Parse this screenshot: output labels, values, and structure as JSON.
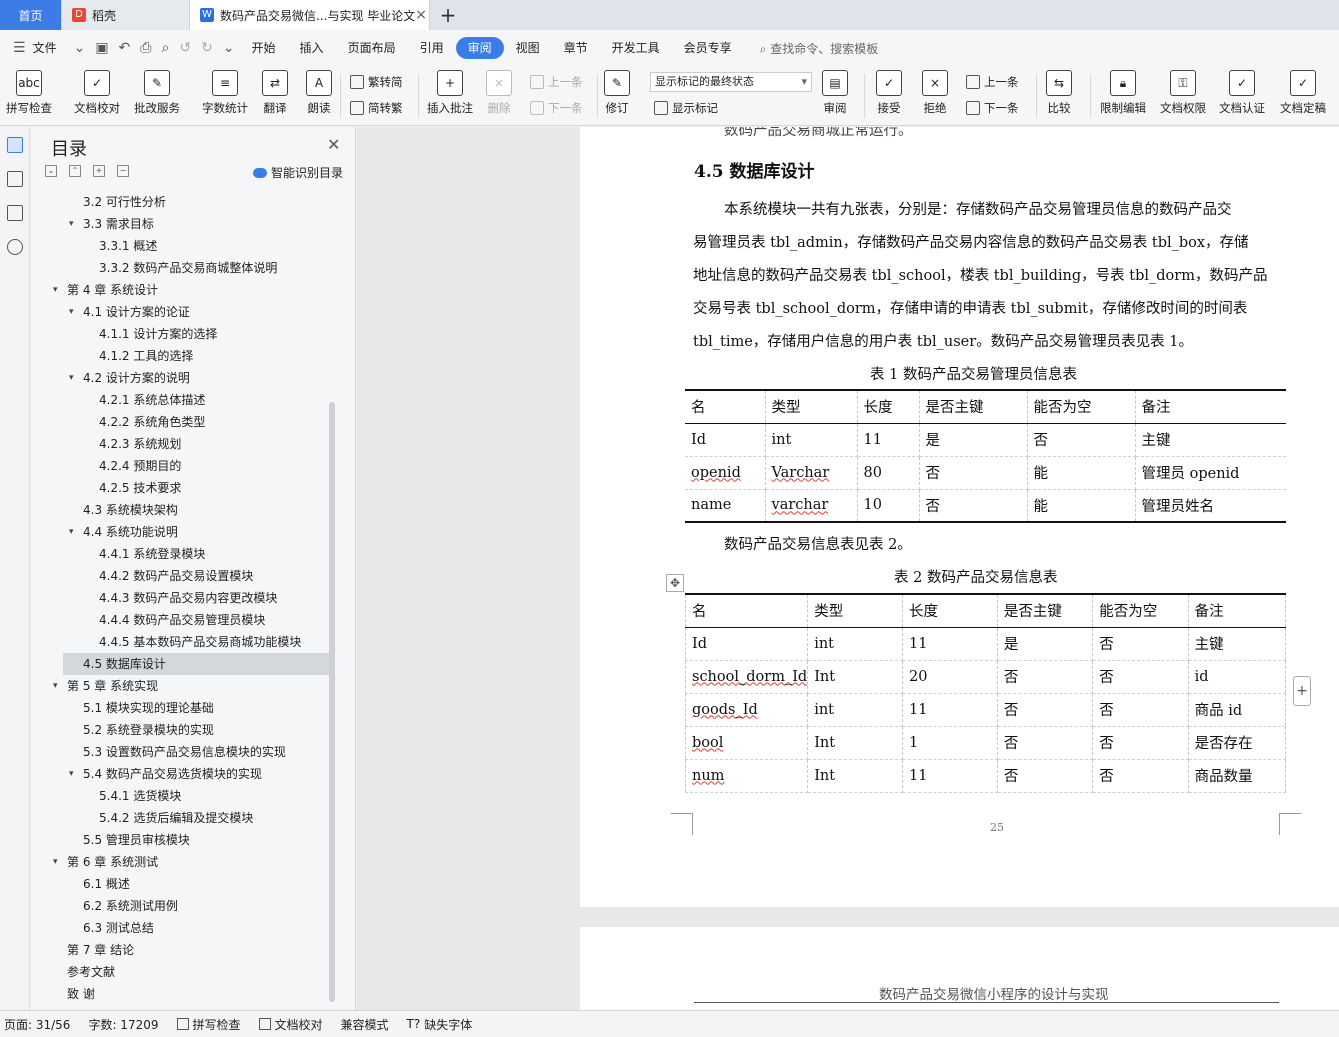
{
  "tabs": {
    "home": "首页",
    "daoke": "稻壳",
    "doc": "数码产品交易微信...与实现 毕业论文",
    "close": "×",
    "add": "+"
  },
  "menu": {
    "file": "文件",
    "items": [
      "开始",
      "插入",
      "页面布局",
      "引用",
      "审阅",
      "视图",
      "章节",
      "开发工具",
      "会员专享"
    ],
    "active": "审阅",
    "search": "查找命令、搜索模板"
  },
  "ribbon": {
    "spell": "拼写检查",
    "proof": "文档校对",
    "correct": "批改服务",
    "wordcount": "字数统计",
    "translate": "翻译",
    "read": "朗读",
    "trad": "繁转简",
    "simp": "简转繁",
    "insert_comment": "插入批注",
    "delete": "删除",
    "prev": "上一条",
    "next": "下一条",
    "revise": "修订",
    "markup_state": "显示标记的最终状态",
    "show_markup": "显示标记",
    "review": "审阅",
    "accept": "接受",
    "reject": "拒绝",
    "prev2": "上一条",
    "next2": "下一条",
    "compare": "比较",
    "restrict": "限制编辑",
    "permission": "文档权限",
    "certify": "文档认证",
    "finalize": "文档定稿"
  },
  "toc": {
    "title": "目录",
    "smart": "智能识别目录",
    "items": [
      {
        "label": "3.2  可行性分析",
        "level": 2
      },
      {
        "label": "3.3  需求目标",
        "level": 2,
        "caret": true
      },
      {
        "label": "3.3.1  概述",
        "level": 3
      },
      {
        "label": "3.3.2  数码产品交易商城整体说明",
        "level": 3
      },
      {
        "label": "第 4 章  系统设计",
        "level": 1,
        "caret": true
      },
      {
        "label": "4.1 设计方案的论证",
        "level": 2,
        "caret": true
      },
      {
        "label": "4.1.1  设计方案的选择",
        "level": 3
      },
      {
        "label": "4.1.2  工具的选择",
        "level": 3
      },
      {
        "label": "4.2  设计方案的说明",
        "level": 2,
        "caret": true
      },
      {
        "label": "4.2.1  系统总体描述",
        "level": 3
      },
      {
        "label": "4.2.2  系统角色类型",
        "level": 3
      },
      {
        "label": "4.2.3  系统规划",
        "level": 3
      },
      {
        "label": "4.2.4  预期目的",
        "level": 3
      },
      {
        "label": "4.2.5  技术要求",
        "level": 3
      },
      {
        "label": "4.3  系统模块架构",
        "level": 2
      },
      {
        "label": "4.4  系统功能说明",
        "level": 2,
        "caret": true
      },
      {
        "label": "4.4.1  系统登录模块",
        "level": 3
      },
      {
        "label": "4.4.2  数码产品交易设置模块",
        "level": 3
      },
      {
        "label": "4.4.3  数码产品交易内容更改模块",
        "level": 3
      },
      {
        "label": "4.4.4  数码产品交易管理员模块",
        "level": 3
      },
      {
        "label": "4.4.5  基本数码产品交易商城功能模块",
        "level": 3
      },
      {
        "label": "4.5  数据库设计",
        "level": 2,
        "selected": true
      },
      {
        "label": "第 5 章  系统实现",
        "level": 1,
        "caret": true
      },
      {
        "label": "5.1  模块实现的理论基础",
        "level": 2
      },
      {
        "label": "5.2  系统登录模块的实现",
        "level": 2
      },
      {
        "label": "5.3  设置数码产品交易信息模块的实现",
        "level": 2
      },
      {
        "label": "5.4  数码产品交易选货模块的实现",
        "level": 2,
        "caret": true
      },
      {
        "label": "5.4.1  选货模块",
        "level": 3
      },
      {
        "label": "5.4.2  选货后编辑及提交模块",
        "level": 3
      },
      {
        "label": "5.5  管理员审核模块",
        "level": 2
      },
      {
        "label": "第 6 章  系统测试",
        "level": 1,
        "caret": true
      },
      {
        "label": "6.1  概述",
        "level": 2
      },
      {
        "label": "6.2  系统测试用例",
        "level": 2
      },
      {
        "label": "6.3  测试总结",
        "level": 2
      },
      {
        "label": "第 7 章  结论",
        "level": 1
      },
      {
        "label": "参考文献",
        "level": 1
      },
      {
        "label": "致    谢",
        "level": 1
      }
    ]
  },
  "document": {
    "top_fragment": "数码产品交易商城正常运行。",
    "heading": "4.5  数据库设计",
    "para_lines": [
      "本系统模块一共有九张表，分别是：存储数码产品交易管理员信息的数码产品交",
      "易管理员表 tbl_admin，存储数码产品交易内容信息的数码产品交易表 tbl_box，存储",
      "地址信息的数码产品交易表 tbl_school，楼表 tbl_building，号表 tbl_dorm，数码产品",
      "交易号表 tbl_school_dorm，存储申请的申请表 tbl_submit，存储修改时间的时间表",
      "tbl_time，存储用户信息的用户表 tbl_user。数码产品交易管理员表见表 1。"
    ],
    "table1_caption": "表 1  数码产品交易管理员信息表",
    "table1": [
      [
        "名",
        "类型",
        "长度",
        "是否主键",
        "能否为空",
        "备注"
      ],
      [
        "Id",
        "int",
        "11",
        "是",
        "否",
        "主键"
      ],
      [
        "openid",
        "Varchar",
        "80",
        "否",
        "能",
        "管理员 openid"
      ],
      [
        "name",
        "varchar",
        "10",
        "否",
        "能",
        "管理员姓名"
      ]
    ],
    "table2_intro": "数码产品交易信息表见表 2。",
    "table2_caption": "表 2  数码产品交易信息表",
    "table2": [
      [
        "名",
        "类型",
        "长度",
        "是否主键",
        "能否为空",
        "备注"
      ],
      [
        "Id",
        "int",
        "11",
        "是",
        "否",
        "主键"
      ],
      [
        "school_dorm_Id",
        "Int",
        "20",
        "否",
        "否",
        "id"
      ],
      [
        "goods_Id",
        "int",
        "11",
        "否",
        "否",
        "商品 id"
      ],
      [
        "bool",
        "Int",
        "1",
        "否",
        "否",
        "是否存在"
      ],
      [
        "num",
        "Int",
        "11",
        "否",
        "否",
        "商品数量"
      ]
    ],
    "page_number": "25",
    "next_page_header": "数码产品交易微信小程序的设计与实现"
  },
  "status": {
    "page": "页面: 31/56",
    "words": "字数: 17209",
    "spell": "拼写检查",
    "proof": "文档校对",
    "compat": "兼容模式",
    "missing_font": "缺失字体"
  }
}
